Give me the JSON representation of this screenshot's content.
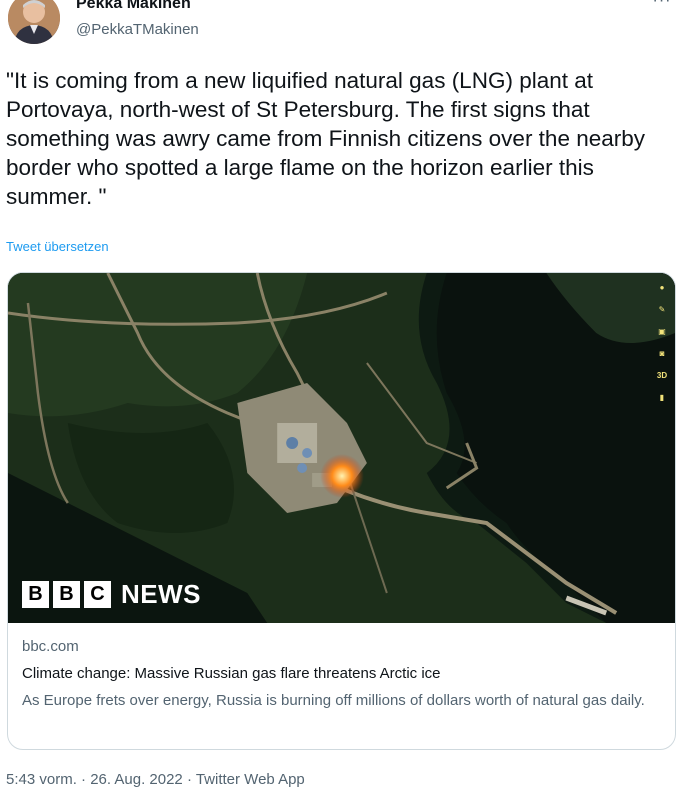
{
  "tweet": {
    "display_name": "Pekka Mäkinen",
    "handle": "@PekkaTMakinen",
    "more_icon": "more-horizontal-icon",
    "text": "\"It is coming from a new liquified natural gas (LNG) plant at Portovaya, north-west of St Petersburg. The first signs that something was awry came from Finnish citizens over the nearby border who spotted a large flame on the horizon earlier this summer. \"",
    "translate_label": "Tweet übersetzen",
    "timestamp": "5:43 vorm. · 26. Aug. 2022 · Twitter Web App"
  },
  "card": {
    "image_overlay": {
      "bbc_letters": [
        "B",
        "B",
        "C"
      ],
      "news_label": "NEWS",
      "map_tool_label": "3D"
    },
    "domain": "bbc.com",
    "title": "Climate change: Massive Russian gas flare threatens Arctic ice",
    "description": "As Europe frets over energy, Russia is burning off millions of dollars worth of natural gas daily."
  },
  "colors": {
    "link": "#1d9bf0",
    "secondary_text": "#536471",
    "primary_text": "#0f1419",
    "border": "#cfd9de",
    "flame": "#ff7a1a"
  }
}
